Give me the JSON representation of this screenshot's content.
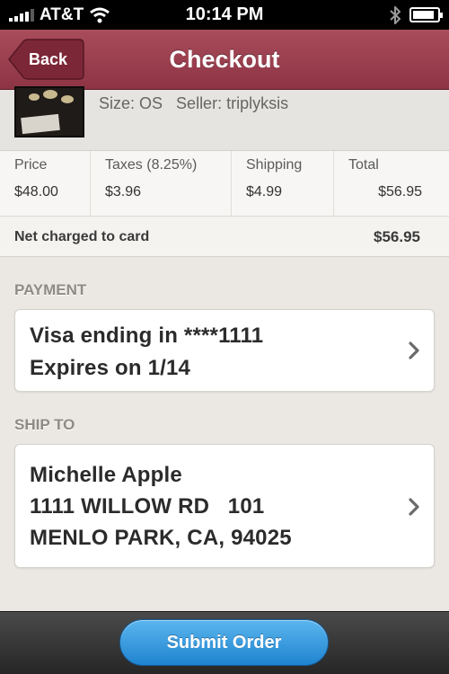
{
  "status_bar": {
    "carrier": "AT&T",
    "time": "10:14 PM",
    "battery_level": 0.9
  },
  "nav": {
    "back_label": "Back",
    "title": "Checkout"
  },
  "product": {
    "size": "Size: OS",
    "seller": "Seller: triplyksis"
  },
  "pricing": {
    "columns": [
      {
        "header": "Price",
        "value": "$48.00"
      },
      {
        "header": "Taxes (8.25%)",
        "value": "$3.96"
      },
      {
        "header": "Shipping",
        "value": "$4.99"
      },
      {
        "header": "Total",
        "value": "$56.95"
      }
    ],
    "net_label": "Net charged to card",
    "net_value": "$56.95"
  },
  "payment": {
    "section_label": "PAYMENT",
    "line1": "Visa ending in ****1111",
    "line2": "Expires on 1/14"
  },
  "ship_to": {
    "section_label": "SHIP TO",
    "name": "Michelle Apple",
    "address1": "1111 WILLOW RD   101",
    "address2": "MENLO PARK, CA, 94025"
  },
  "toolbar": {
    "submit_label": "Submit Order"
  },
  "colors": {
    "nav_bar": "#9b3f4f",
    "submit_button": "#2f93dc",
    "background": "#ebe8e3"
  }
}
